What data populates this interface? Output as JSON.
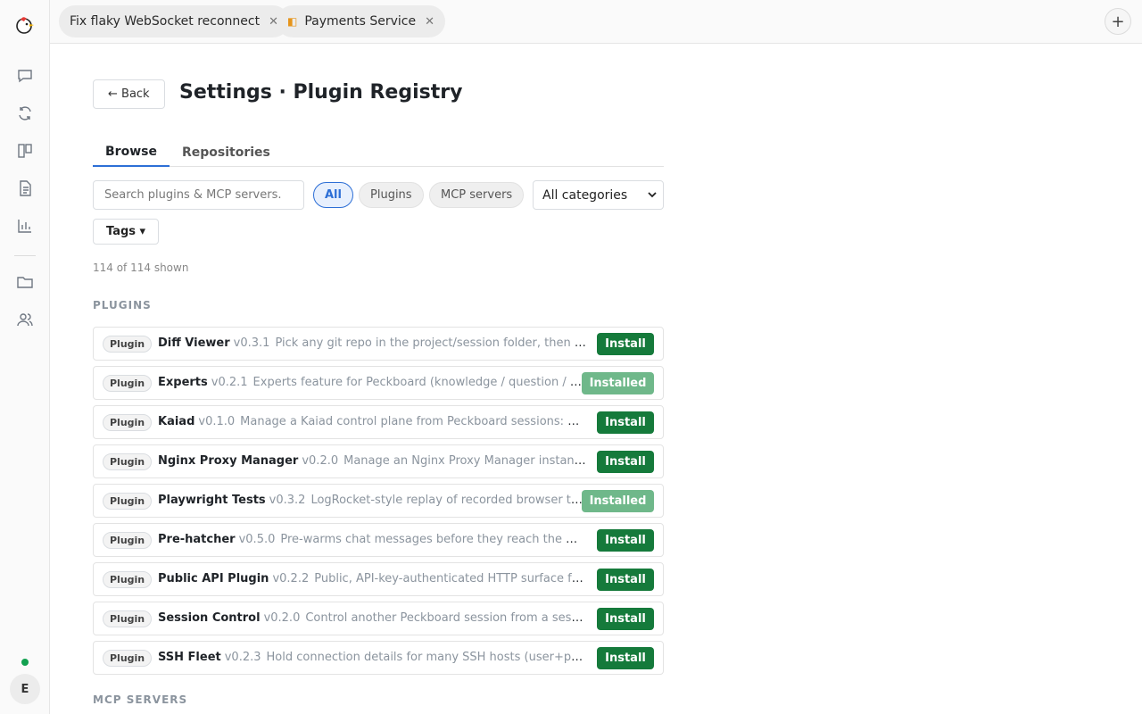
{
  "tabs": [
    {
      "label": "Fix flaky WebSocket reconnect",
      "icon": ""
    },
    {
      "label": "Payments Service",
      "icon": "◧"
    }
  ],
  "rail": {
    "icons": [
      "chat-icon",
      "refresh-icon",
      "board-icon",
      "document-icon",
      "chart-icon",
      "folder-icon",
      "users-icon"
    ],
    "avatar": "E",
    "status_color": "#12a150"
  },
  "page": {
    "back_label": "← Back",
    "title": "Settings · Plugin Registry",
    "tabs": [
      "Browse",
      "Repositories"
    ],
    "active_tab": "Browse"
  },
  "filters": {
    "search_placeholder": "Search plugins & MCP servers.",
    "pills": [
      "All",
      "Plugins",
      "MCP servers"
    ],
    "active_pill": "All",
    "category": "All categories",
    "tags_label": "Tags ▾"
  },
  "count_text": "114 of 114 shown",
  "sections": {
    "plugins": "PLUGINS",
    "mcp": "MCP SERVERS"
  },
  "plugins": [
    {
      "badge": "Plugin",
      "name": "Diff Viewer",
      "version": "v0.3.1",
      "desc": "Pick any git repo in the project/session folder, then get a side-by-side diff",
      "action": "Install"
    },
    {
      "badge": "Plugin",
      "name": "Experts",
      "version": "v0.2.1",
      "desc": "Experts feature for Peckboard (knowledge / question / Pair)",
      "action": "Installed"
    },
    {
      "badge": "Plugin",
      "name": "Kaiad",
      "version": "v0.1.0",
      "desc": "Manage a Kaiad control plane from Peckboard sessions: bridge",
      "action": "Install"
    },
    {
      "badge": "Plugin",
      "name": "Nginx Proxy Manager",
      "version": "v0.2.0",
      "desc": "Manage an Nginx Proxy Manager instance from",
      "action": "Install"
    },
    {
      "badge": "Plugin",
      "name": "Playwright Tests",
      "version": "v0.3.2",
      "desc": "LogRocket-style replay of recorded browser tests",
      "action": "Installed"
    },
    {
      "badge": "Plugin",
      "name": "Pre-hatcher",
      "version": "v0.5.0",
      "desc": "Pre-warms chat messages before they reach the main agent",
      "action": "Install"
    },
    {
      "badge": "Plugin",
      "name": "Public API Plugin",
      "version": "v0.2.2",
      "desc": "Public, API-key-authenticated HTTP surface for Peckboard",
      "action": "Install"
    },
    {
      "badge": "Plugin",
      "name": "Session Control",
      "version": "v0.2.0",
      "desc": "Control another Peckboard session from a session",
      "action": "Install"
    },
    {
      "badge": "Plugin",
      "name": "SSH Fleet",
      "version": "v0.2.3",
      "desc": "Hold connection details for many SSH hosts (user+password)",
      "action": "Install"
    }
  ],
  "colors": {
    "accent": "#2d6fd6",
    "install": "#157a3b",
    "installed": "#6fb88a"
  }
}
